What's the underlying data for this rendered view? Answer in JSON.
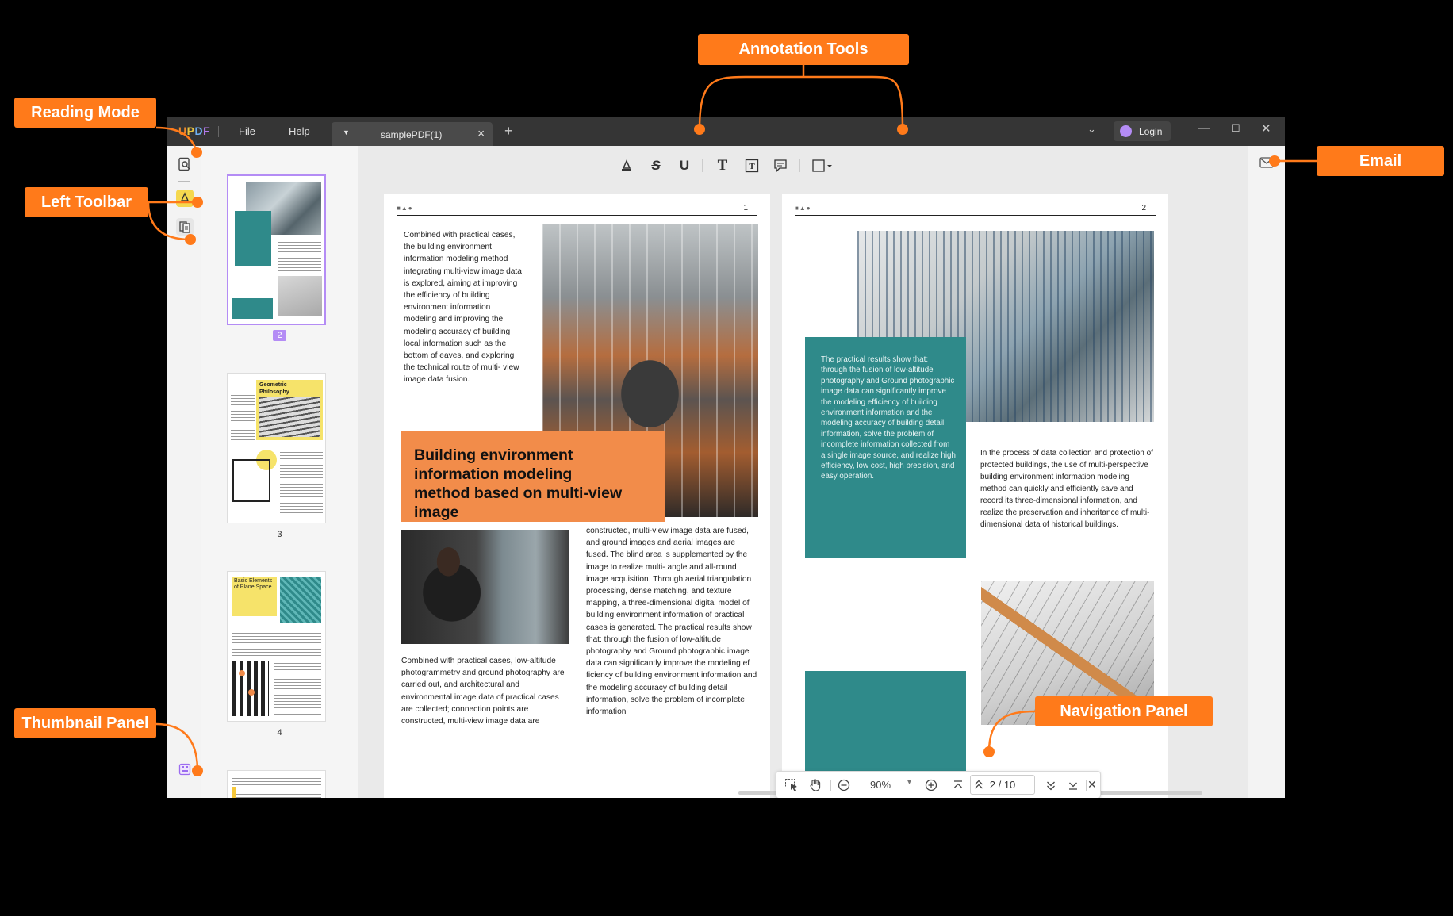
{
  "callouts": {
    "reading_mode": "Reading Mode",
    "left_toolbar": "Left Toolbar",
    "thumbnail_panel": "Thumbnail Panel",
    "annotation_tools": "Annotation Tools",
    "email": "Email",
    "navigation_panel": "Navigation Panel"
  },
  "titlebar": {
    "logo": [
      "U",
      "P",
      "D",
      "F"
    ],
    "menu": [
      "File",
      "Help"
    ],
    "tab_name": "samplePDF(1)",
    "tab_close": "×",
    "new_tab": "+",
    "tab_list": "⌄",
    "login": "Login",
    "minimize": "—",
    "maximize": "☐",
    "close": "✕"
  },
  "left_toolbar": {
    "icons": [
      "reader-mode-icon",
      "comment-mode-icon",
      "organize-pages-icon",
      "thumbnail-toggle-icon"
    ]
  },
  "thumbnails": [
    {
      "number": "2",
      "active": true
    },
    {
      "number": "3",
      "active": false,
      "heading": "Geometric Philosophy"
    },
    {
      "number": "4",
      "active": false,
      "heading": "Basic Elements of Plane Space"
    },
    {
      "number": "",
      "active": false
    }
  ],
  "annotation_tools": [
    "highlight-icon",
    "strikethrough-icon",
    "underline-icon",
    "text-icon",
    "textbox-icon",
    "note-icon",
    "shape-icon"
  ],
  "annotation_labels": {
    "strike": "S",
    "underline": "U",
    "text": "T",
    "textbox": "T"
  },
  "page1": {
    "marks": "■▲●",
    "number": "1",
    "intro": "Combined with practical cases, the building environment information modeling method integrating multi-view image data is explored, aiming at improving the efficiency of building environment information modeling and improving the modeling accuracy of building local information such as the bottom of eaves, and exploring the technical route of multi- view image data fusion.",
    "headline": "Building environment information modeling method based on multi-view image",
    "left_bottom": "Combined with practical cases, low-altitude photogrammetry and ground photography are carried out, and architectural and environmental image data of practical cases are collected; connection points are constructed, multi-view image data are",
    "right_column": "constructed, multi-view image data are fused, and ground images and aerial images are fused. The blind area is supplemented by the image to realize multi- angle and all-round image acquisition. Through aerial triangulation processing, dense matching, and texture mapping, a three-dimensional digital model of building environment information of practical cases is generated. The practical results show that: through the fusion of low-altitude photography and Ground photographic image data can significantly improve the modeling ef ficiency of building environment information and the modeling accuracy of building detail information, solve the problem of incomplete information"
  },
  "page2": {
    "marks": "■▲●",
    "number": "2",
    "teal_text": "The practical results show that: through the fusion of low-altitude photography and Ground photographic image data can significantly improve the modeling efficiency of building environment information and the modeling accuracy of building detail information, solve the problem of incomplete information collected from a single image source, and realize high efficiency, low cost, high precision, and easy operation.",
    "right_text": "In the process of data collection and protection of protected buildings, the use of multi-perspective building environment information modeling method can quickly and efficiently save and record its three-dimensional information, and realize the preservation and inheritance of multi-dimensional data of historical buildings."
  },
  "navigation": {
    "zoom": "90%",
    "zoom_dropdown": "▾",
    "current_page": "2",
    "separator": "/",
    "total_pages": "10"
  }
}
